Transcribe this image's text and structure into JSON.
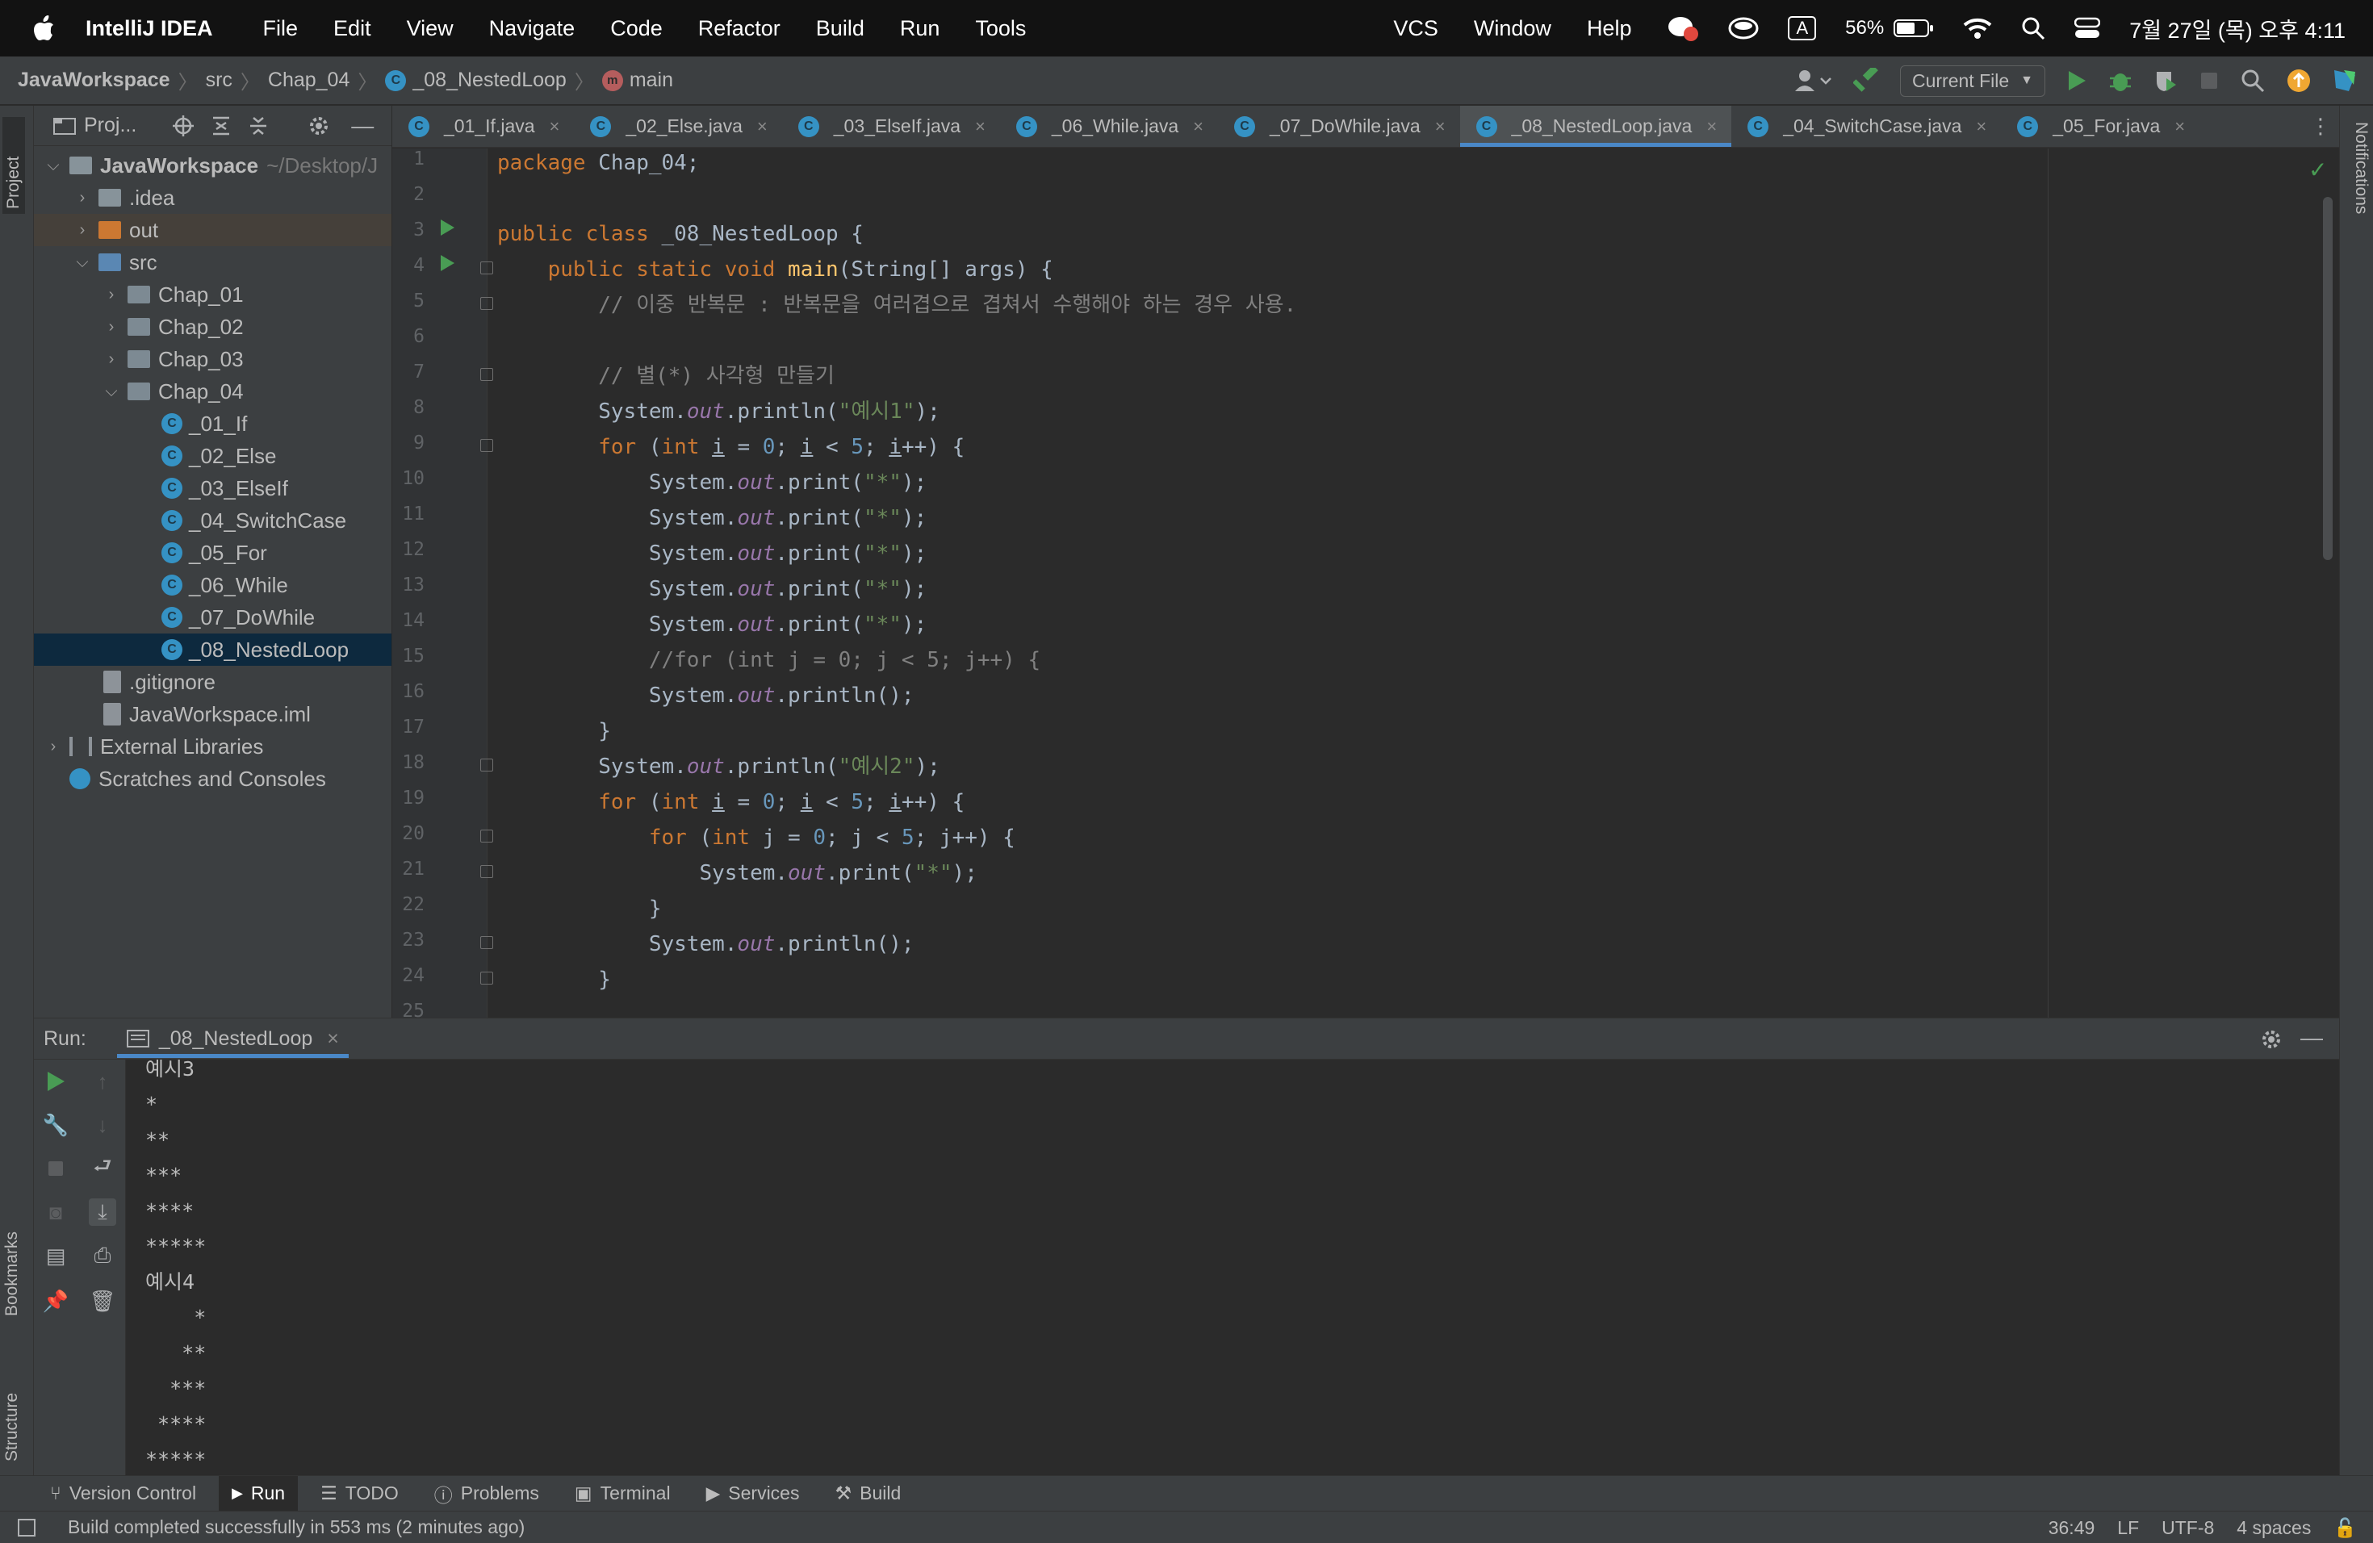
{
  "menubar": {
    "app_name": "IntelliJ IDEA",
    "menus": [
      "File",
      "Edit",
      "View",
      "Navigate",
      "Code",
      "Refactor",
      "Build",
      "Run",
      "Tools"
    ],
    "right_menus": [
      "VCS",
      "Window",
      "Help"
    ],
    "input_indicator": "A",
    "battery": "56%",
    "datetime": "7월 27일 (목) 오후 4:11"
  },
  "breadcrumb": {
    "project": "JavaWorkspace",
    "src": "src",
    "package": "Chap_04",
    "file": "_08_NestedLoop",
    "method": "main"
  },
  "navbar": {
    "run_config": "Current File"
  },
  "project_panel": {
    "title": "Proj...",
    "root": "JavaWorkspace",
    "root_path": "~/Desktop/J",
    "idea": ".idea",
    "out": "out",
    "src": "src",
    "chap01": "Chap_01",
    "chap02": "Chap_02",
    "chap03": "Chap_03",
    "chap04": "Chap_04",
    "files": [
      "_01_If",
      "_02_Else",
      "_03_ElseIf",
      "_04_SwitchCase",
      "_05_For",
      "_06_While",
      "_07_DoWhile",
      "_08_NestedLoop"
    ],
    "gitignore": ".gitignore",
    "iml": "JavaWorkspace.iml",
    "external": "External Libraries",
    "scratches": "Scratches and Consoles"
  },
  "editor_tabs": [
    "_01_If.java",
    "_02_Else.java",
    "_03_ElseIf.java",
    "_06_While.java",
    "_07_DoWhile.java",
    "_08_NestedLoop.java",
    "_04_SwitchCase.java",
    "_05_For.java"
  ],
  "active_tab_index": 5,
  "code": {
    "l1a": "package",
    "l1b": " Chap_04;",
    "l3a": "public class",
    "l3b": " _08_NestedLoop {",
    "l4a": "public static void",
    "l4b": "main",
    "l4c": "(String[] args) {",
    "l5": "// 이중 반복문 : 반복문을 여러겹으로 겹쳐서 수행해야 하는 경우 사용.",
    "l7": "// 별(*) 사각형 만들기",
    "sys": "System.",
    "out": "out",
    "println": ".println(",
    "print": ".print(",
    "ex1": "\"예시1\"",
    "ex2": "\"예시2\"",
    "star": "\"*\"",
    "close_paren": ");",
    "println_empty": ".println();",
    "for_kw": "for",
    "int_kw": "int",
    "for_i_a": " (",
    "for_i_b": " i",
    " for_i_c": "",
    "l15": "//for (int j = 0; j < 5; j++) {",
    "brace_close": "}",
    "zero": "0",
    "five": "5"
  },
  "line_numbers": [
    "1",
    "2",
    "3",
    "4",
    "5",
    "6",
    "7",
    "8",
    "9",
    "10",
    "11",
    "12",
    "13",
    "14",
    "15",
    "16",
    "17",
    "18",
    "19",
    "20",
    "21",
    "22",
    "23",
    "24",
    "25"
  ],
  "run_panel": {
    "label": "Run:",
    "tab": "_08_NestedLoop",
    "console": [
      "예시3",
      "*",
      "**",
      "***",
      "****",
      "*****",
      "예시4",
      "    *",
      "   **",
      "  ***",
      " ****",
      "*****"
    ]
  },
  "bottom_tools": [
    "Version Control",
    "Run",
    "TODO",
    "Problems",
    "Terminal",
    "Services",
    "Build"
  ],
  "side_tabs": {
    "project": "Project",
    "bookmarks": "Bookmarks",
    "structure": "Structure",
    "notifications": "Notifications"
  },
  "status": {
    "message": "Build completed successfully in 553 ms (2 minutes ago)",
    "position": "36:49",
    "line_sep": "LF",
    "encoding": "UTF-8",
    "indent": "4 spaces"
  },
  "colors": {
    "keyword": "#cc7832",
    "string": "#6a8759",
    "number": "#6897bb",
    "field": "#9876aa",
    "comment": "#808080",
    "method_decl": "#ffc66d",
    "accent": "#4a88c7",
    "run_green": "#499c54"
  }
}
